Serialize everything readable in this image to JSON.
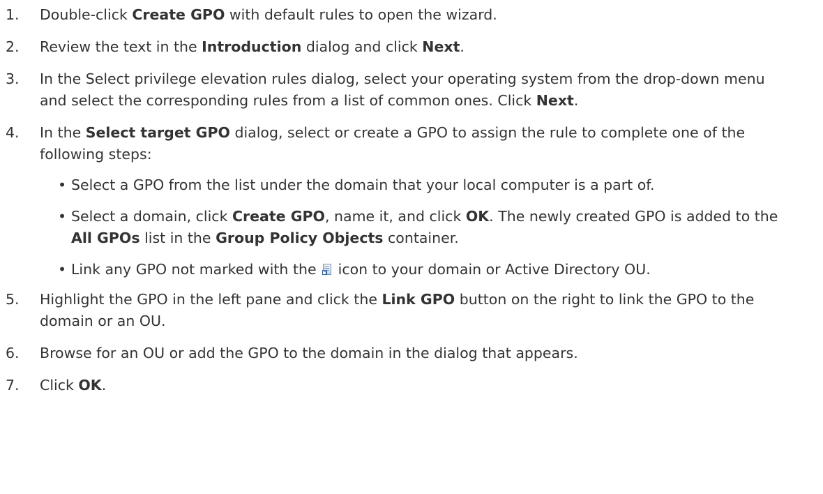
{
  "steps": [
    {
      "num": "1.",
      "parts": [
        "Double-click ",
        "Create GPO",
        " with default rules to open the wizard."
      ]
    },
    {
      "num": "2.",
      "parts": [
        "Review the text in the ",
        "Introduction",
        " dialog and click ",
        "Next",
        "."
      ]
    },
    {
      "num": "3.",
      "parts": [
        "In the Select privilege elevation rules dialog, select your operating system from the drop-down menu and select the corresponding rules from a list of common ones. Click ",
        "Next",
        "."
      ]
    },
    {
      "num": "4.",
      "parts": [
        "In the ",
        "Select target GPO",
        " dialog, select or create a GPO to assign the rule to complete one of the following steps:"
      ],
      "sub": [
        {
          "bullet": "•",
          "parts": [
            "Select a GPO from the list under the domain that your local computer is a part of."
          ]
        },
        {
          "bullet": "•",
          "parts": [
            "Select a domain, click ",
            "Create GPO",
            ", name it, and click ",
            "OK",
            ". The newly created GPO is added to the ",
            "All GPOs",
            " list in the ",
            "Group Policy Objects",
            " container."
          ]
        },
        {
          "bullet": "•",
          "parts": [
            "Link any GPO not marked with the ",
            " icon to your domain or Active Directory OU."
          ],
          "icon": "gpo-link-icon"
        }
      ]
    },
    {
      "num": "5.",
      "parts": [
        "Highlight the GPO in the left pane and click the ",
        "Link GPO",
        " button on the right to link the GPO to the domain or an OU."
      ]
    },
    {
      "num": "6.",
      "parts": [
        "Browse for an OU or add the GPO to the domain in the dialog that appears."
      ]
    },
    {
      "num": "7.",
      "parts": [
        "Click ",
        "OK",
        "."
      ]
    }
  ]
}
